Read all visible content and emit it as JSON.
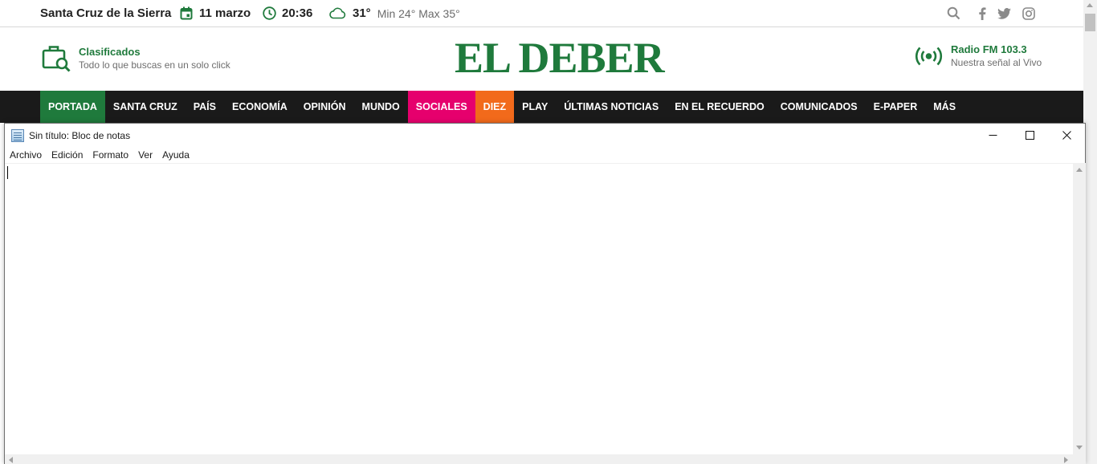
{
  "topbar": {
    "city": "Santa Cruz de la Sierra",
    "date": "11 marzo",
    "time": "20:36",
    "temp": "31°",
    "minmax": "Min 24° Max 35°",
    "icons": [
      "calendar-icon",
      "clock-icon",
      "cloud-icon",
      "search-icon",
      "facebook-icon",
      "twitter-icon",
      "instagram-icon"
    ]
  },
  "header": {
    "clasificados_title": "Clasificados",
    "clasificados_sub": "Todo lo que buscas en un solo click",
    "logo": "EL DEBER",
    "radio_title": "Radio FM 103.3",
    "radio_sub": "Nuestra señal al Vivo"
  },
  "nav": {
    "items": [
      {
        "label": "PORTADA"
      },
      {
        "label": "SANTA CRUZ"
      },
      {
        "label": "PAÍS"
      },
      {
        "label": "ECONOMÍA"
      },
      {
        "label": "OPINIÓN"
      },
      {
        "label": "MUNDO"
      },
      {
        "label": "SOCIALES"
      },
      {
        "label": "DIEZ"
      },
      {
        "label": "PLAY"
      },
      {
        "label": "ÚLTIMAS NOTICIAS"
      },
      {
        "label": "EN EL RECUERDO"
      },
      {
        "label": "COMUNICADOS"
      },
      {
        "label": "E-PAPER"
      },
      {
        "label": "MÁS"
      }
    ]
  },
  "notepad": {
    "title": "Sin título: Bloc de notas",
    "menu": [
      "Archivo",
      "Edición",
      "Formato",
      "Ver",
      "Ayuda"
    ],
    "content": ""
  },
  "colors": {
    "brand_green": "#1f7a3c",
    "nav_bg": "#1a1a1a",
    "sociales_pink": "#e6006d",
    "diez_orange": "#f26a1b"
  }
}
